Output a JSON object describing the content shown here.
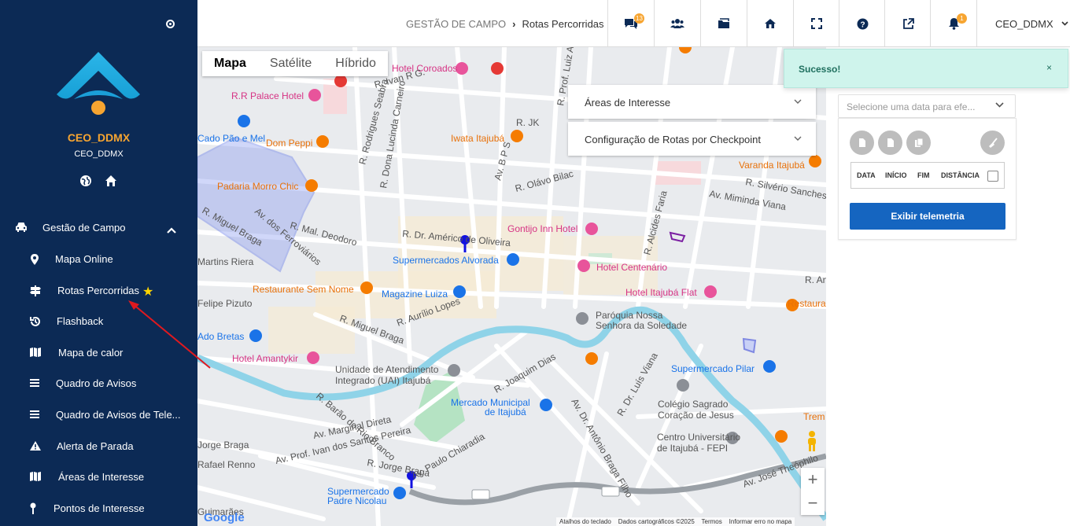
{
  "sidebar": {
    "user_name": "CEO_DDMX",
    "user_sub": "CEO_DDMX",
    "group_label": "Gestão de Campo",
    "items": [
      {
        "label": "Mapa Online",
        "icon": "map-marker-icon"
      },
      {
        "label": "Rotas Percorridas",
        "icon": "signpost-icon"
      },
      {
        "label": "Flashback",
        "icon": "history-icon"
      },
      {
        "label": "Mapa de calor",
        "icon": "map-icon"
      },
      {
        "label": "Quadro de Avisos",
        "icon": "list-icon"
      },
      {
        "label": "Quadro de Avisos de Tele...",
        "icon": "list-icon"
      },
      {
        "label": "Alerta de Parada",
        "icon": "warning-icon"
      },
      {
        "label": "Áreas de Interesse",
        "icon": "map-icon"
      },
      {
        "label": "Pontos de Interesse",
        "icon": "pin-icon"
      }
    ]
  },
  "topbar": {
    "breadcrumb_parent": "GESTÃO DE CAMPO",
    "breadcrumb_current": "Rotas Percorridas",
    "badge_messages": "13",
    "badge_notifications": "1",
    "user": "CEO_DDMX"
  },
  "map": {
    "type_tabs": [
      "Mapa",
      "Satélite",
      "Híbrido"
    ],
    "active_tab": "Mapa",
    "panels": [
      "Áreas de Interesse",
      "Configuração de Rotas por Checkpoint"
    ],
    "attribution": [
      "Atalhos do teclado",
      "Dados cartográficos ©2025",
      "Termos",
      "Informar erro no mapa"
    ],
    "google": "Google",
    "labels": [
      {
        "t": "Hotel Coroados",
        "c": "#d63384"
      },
      {
        "t": "R.R Palace Hotel",
        "c": "#d63384"
      },
      {
        "t": "R. Ivan R G.",
        "c": "#555"
      },
      {
        "t": "Cado Pão e Mel",
        "c": "#1a73e8"
      },
      {
        "t": "Dom Peppi",
        "c": "#e8710a"
      },
      {
        "t": "Iwata Itajubá",
        "c": "#e8710a"
      },
      {
        "t": "Padaria Morro Chic",
        "c": "#e8710a"
      },
      {
        "t": "R. Miguel Braga",
        "c": "#555"
      },
      {
        "t": "R. Mal. Deodoro",
        "c": "#555"
      },
      {
        "t": "Av. dos Ferroviários",
        "c": "#555"
      },
      {
        "t": "R. Dr. Américo de Oliveira",
        "c": "#555"
      },
      {
        "t": "Gontijo Inn Hotel",
        "c": "#d63384"
      },
      {
        "t": "Supermercados Alvorada",
        "c": "#1a73e8"
      },
      {
        "t": "Hotel Centenário",
        "c": "#d63384"
      },
      {
        "t": "Restaurante Sem Nome",
        "c": "#e8710a"
      },
      {
        "t": "Magazine Luiza",
        "c": "#1a73e8"
      },
      {
        "t": "Hotel Itajubá Flat",
        "c": "#d63384"
      },
      {
        "t": "Paróquia Nossa",
        "c": "#555"
      },
      {
        "t": "Senhora da Soledade",
        "c": "#555"
      },
      {
        "t": "R. Aurílio Lopes",
        "c": "#555"
      },
      {
        "t": "R. Miguel Braga",
        "c": "#555"
      },
      {
        "t": "Ado Bretas",
        "c": "#1a73e8"
      },
      {
        "t": "Hotel Amantykir",
        "c": "#d63384"
      },
      {
        "t": "Unidade de Atendimento",
        "c": "#555"
      },
      {
        "t": "Integrado (UAI) Itajubá",
        "c": "#555"
      },
      {
        "t": "R. Joaquim Dias",
        "c": "#555"
      },
      {
        "t": "Supermercado Pilar",
        "c": "#1a73e8"
      },
      {
        "t": "Colégio Sagrado",
        "c": "#555"
      },
      {
        "t": "Coração de Jesus",
        "c": "#555"
      },
      {
        "t": "Mercado Municipal",
        "c": "#1a73e8"
      },
      {
        "t": "de Itajubá",
        "c": "#1a73e8"
      },
      {
        "t": "Centro Universitário",
        "c": "#555"
      },
      {
        "t": "de Itajubá - FEPI",
        "c": "#555"
      },
      {
        "t": "Av. Marginal Direta",
        "c": "#555"
      },
      {
        "t": "Av. Prof. Ivan dos Santos Pereira",
        "c": "#555"
      },
      {
        "t": "R. Jorge Braga",
        "c": "#555"
      },
      {
        "t": "Av. Paulo Chiaradia",
        "c": "#555"
      },
      {
        "t": "Supermercado",
        "c": "#1a73e8"
      },
      {
        "t": "Padre Nicolau",
        "c": "#1a73e8"
      },
      {
        "t": "R. Silvério Sanches",
        "c": "#555"
      },
      {
        "t": "Av. Miminda Viana",
        "c": "#555"
      },
      {
        "t": "Varanda Itajubá",
        "c": "#e8710a"
      },
      {
        "t": "R. Olávo Bilac",
        "c": "#555"
      },
      {
        "t": "R. JK",
        "c": "#555"
      },
      {
        "t": "R. Rodrigues Seabra",
        "c": "#555"
      },
      {
        "t": "R. Dona Lucinda Carneiro",
        "c": "#555"
      },
      {
        "t": "Av. Dr. Antônio Braga Filho",
        "c": "#555"
      },
      {
        "t": "R. Dr. Luís Viana",
        "c": "#555"
      },
      {
        "t": "Av. José Theóphilo",
        "c": "#555"
      },
      {
        "t": "R. Alcides Faria",
        "c": "#555"
      },
      {
        "t": "Av. B P S",
        "c": "#555"
      },
      {
        "t": "R. Prof. Luiz Ant.",
        "c": "#555"
      },
      {
        "t": "Restaurante",
        "c": "#e8710a"
      },
      {
        "t": "R. Barão do Rio Branco",
        "c": "#555"
      },
      {
        "t": "Martins Riera",
        "c": "#555"
      },
      {
        "t": "Felipe Pizuto",
        "c": "#555"
      },
      {
        "t": "Jorge Braga",
        "c": "#555"
      },
      {
        "t": "Rafael Renno",
        "c": "#555"
      },
      {
        "t": "Guimarães",
        "c": "#555"
      },
      {
        "t": "459",
        "c": "#555"
      },
      {
        "t": "459",
        "c": "#555"
      },
      {
        "t": "Trem",
        "c": "#e8710a"
      },
      {
        "t": "R. Ante",
        "c": "#555"
      }
    ]
  },
  "right": {
    "toast": "Sucesso!",
    "toast_close": "×",
    "date_placeholder": "Selecione uma data para efe...",
    "table_headers": [
      "DATA",
      "INÍCIO",
      "FIM",
      "DISTÂNCIA"
    ],
    "button": "Exibir telemetria"
  },
  "colors": {
    "sidebar": "#0c2a55",
    "accent": "#f7a531",
    "primary": "#1565c0",
    "toast_bg": "#cff4ec"
  }
}
